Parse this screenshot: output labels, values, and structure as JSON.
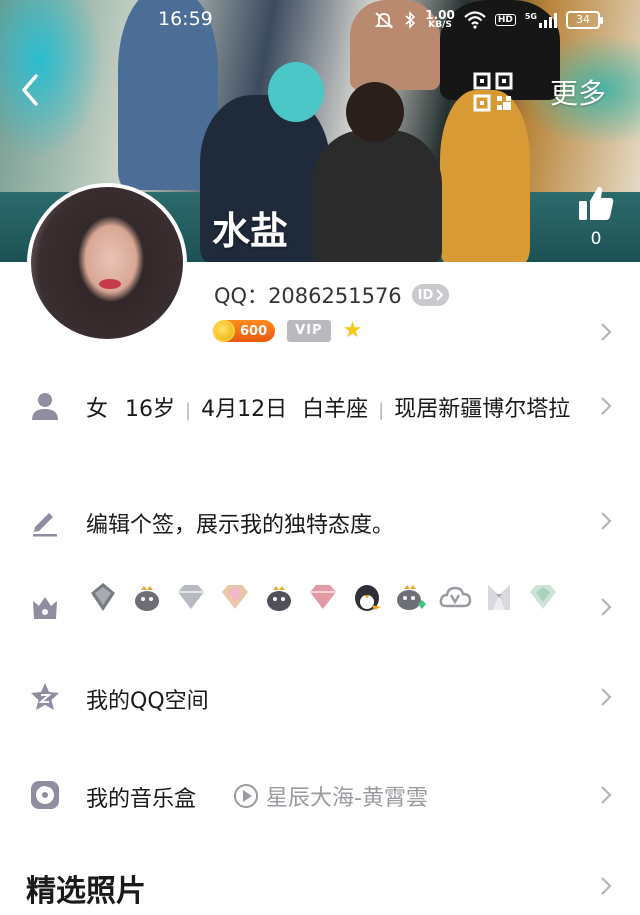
{
  "status_bar": {
    "time": "16:59",
    "speed_value": "1.00",
    "speed_unit": "KB/S",
    "hd": "HD",
    "network": "5G",
    "battery": "34"
  },
  "header": {
    "more_label": "更多",
    "nickname": "水盐",
    "like_count": "0"
  },
  "profile": {
    "qq_label": "QQ：",
    "qq_number": "2086251576",
    "id_badge": "ID",
    "coin_value": "600",
    "vip_label": "VIP"
  },
  "info": {
    "gender": "女",
    "age": "16岁",
    "birthday": "4月12日",
    "zodiac": "白羊座",
    "location": "现居新疆博尔塔拉"
  },
  "signature": {
    "text": "编辑个签，展示我的独特态度。"
  },
  "medals": {
    "icons": [
      "medal-diamond-gray-icon",
      "medal-penguin-crown-icon",
      "medal-diamond-silver-icon",
      "medal-diamond-pink-icon",
      "medal-penguin-crown-icon",
      "medal-diamond-red-icon",
      "medal-penguin-icon",
      "medal-penguin-gem-icon",
      "medal-cloud-v-icon",
      "medal-tuxedo-icon",
      "medal-diamond-green-icon"
    ]
  },
  "qzone": {
    "label": "我的QQ空间"
  },
  "music": {
    "label": "我的音乐盒",
    "song": "星辰大海-黄霄雲"
  },
  "photos": {
    "title": "精选照片"
  },
  "colors": {
    "icon_gray": "#8e8ea0",
    "chevron": "#b5b5bd",
    "text_primary": "#1a1a1a"
  }
}
